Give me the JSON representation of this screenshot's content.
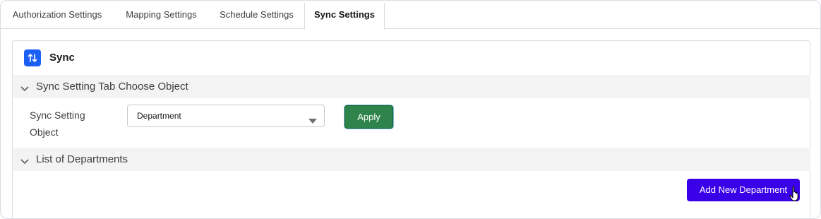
{
  "tabs": [
    {
      "label": "Authorization Settings",
      "active": false
    },
    {
      "label": "Mapping Settings",
      "active": false
    },
    {
      "label": "Schedule Settings",
      "active": false
    },
    {
      "label": "Sync Settings",
      "active": true
    }
  ],
  "card": {
    "icon": "sync-arrows-icon",
    "title": "Sync"
  },
  "sections": {
    "choose_object": {
      "title": "Sync Setting Tab Choose Object",
      "expanded": true,
      "field_label": "Sync Setting Object",
      "select_value": "Department",
      "apply_label": "Apply"
    },
    "departments": {
      "title": "List of Departments",
      "expanded": true,
      "add_button_label": "Add New Department"
    }
  },
  "colors": {
    "accent_blue": "#1b5ff5",
    "apply_green": "#2e844a",
    "add_button": "#3a00e8",
    "section_bg": "#f3f3f3"
  }
}
